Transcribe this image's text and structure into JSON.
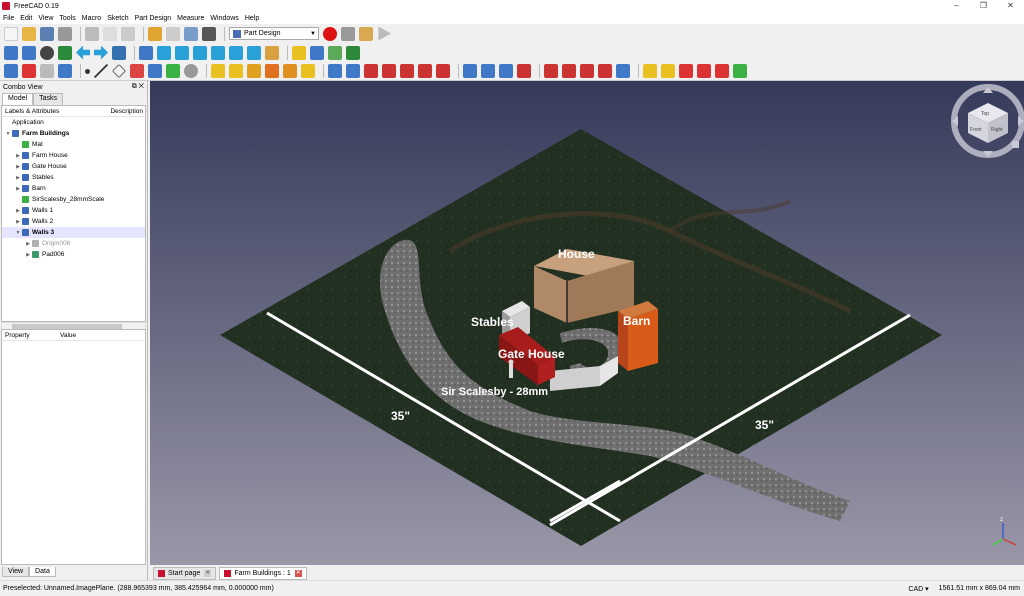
{
  "window": {
    "title": "FreeCAD 0.19",
    "minimize": "–",
    "maximize": "❐",
    "close": "✕"
  },
  "menu": [
    "File",
    "Edit",
    "View",
    "Tools",
    "Macro",
    "Sketch",
    "Part Design",
    "Measure",
    "Windows",
    "Help"
  ],
  "workbench": {
    "selected": "Part Design"
  },
  "combo_view": {
    "title": "Combo View",
    "tabs": [
      "Model",
      "Tasks"
    ],
    "tree_header": {
      "labels": "Labels & Attributes",
      "description": "Description"
    },
    "tree": [
      {
        "label": "Application",
        "indent": 0,
        "arrow": "",
        "icon": ""
      },
      {
        "label": "Farm Buildings",
        "indent": 0,
        "arrow": "▼",
        "icon": "#3d6ab8",
        "bold": true
      },
      {
        "label": "Mat",
        "indent": 1,
        "arrow": "",
        "icon": "#3bb143"
      },
      {
        "label": "Farm House",
        "indent": 1,
        "arrow": "▶",
        "icon": "#3d6ab8"
      },
      {
        "label": "Gate House",
        "indent": 1,
        "arrow": "▶",
        "icon": "#3d6ab8"
      },
      {
        "label": "Stables",
        "indent": 1,
        "arrow": "▶",
        "icon": "#3d6ab8"
      },
      {
        "label": "Barn",
        "indent": 1,
        "arrow": "▶",
        "icon": "#3d6ab8"
      },
      {
        "label": "SirScalesby_28mmScale",
        "indent": 1,
        "arrow": "",
        "icon": "#3bb143"
      },
      {
        "label": "Walls 1",
        "indent": 1,
        "arrow": "▶",
        "icon": "#3d6ab8"
      },
      {
        "label": "Walls 2",
        "indent": 1,
        "arrow": "▶",
        "icon": "#3d6ab8"
      },
      {
        "label": "Walls 3",
        "indent": 1,
        "arrow": "▼",
        "icon": "#3d6ab8",
        "bold": true,
        "selected": true
      },
      {
        "label": "Origin006",
        "indent": 2,
        "arrow": "▶",
        "icon": "#b0b0b0",
        "grey": true
      },
      {
        "label": "Pad006",
        "indent": 2,
        "arrow": "▶",
        "icon": "#3d9b6a"
      }
    ],
    "property_header": {
      "property": "Property",
      "value": "Value"
    },
    "bottom_tabs": [
      "View",
      "Data"
    ]
  },
  "scene": {
    "labels": {
      "house": "House",
      "stables": "Stables",
      "barn": "Barn",
      "gate_house": "Gate House",
      "scale_figure": "Sir Scalesby - 28mm",
      "dim_left": "35\"",
      "dim_right": "35\""
    },
    "colors": {
      "house": "#b08a68",
      "barn": "#d95b1a",
      "gate_house": "#8a1616",
      "stables": "#c8c8c8",
      "mat": "#2a3a2a",
      "river": "#7a7a7a"
    }
  },
  "nav_cube": {
    "top": "Top",
    "front": "Front",
    "right": "Right"
  },
  "doc_tabs": [
    {
      "label": "Start page",
      "active": false
    },
    {
      "label": "Farm Buildings : 1",
      "active": true
    }
  ],
  "status": {
    "preselected": "Preselected: Unnamed.ImagePlane. (288.965393 mm, 385.425964 mm, 0.000000 mm)",
    "nav_style": "CAD ▾",
    "dimensions": "1561.51 mm x 869.04 mm"
  }
}
